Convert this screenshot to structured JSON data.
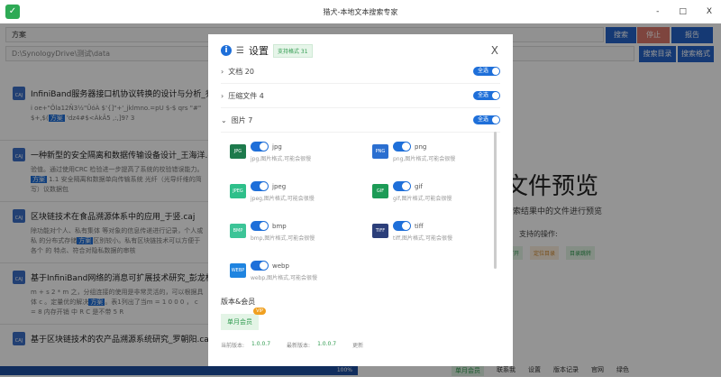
{
  "window": {
    "title": "猎犬-本地文本搜索专家",
    "minimize": "-",
    "maximize": "□",
    "close": "X"
  },
  "search": {
    "query": "方案",
    "path": "D:\\SynologyDrive\\测试\\data",
    "search_btn": "搜索",
    "stop_btn": "停止",
    "report_btn": "报告",
    "dir_btn": "搜索目录",
    "format_btn": "搜索格式"
  },
  "results": [
    {
      "title": "InfiniBand服务器接口机协议转换的设计与分析_乔楠.caj",
      "snippet_pre": "i oe+\"Ôla12Ñ3½\"ÛóÀ $'{]\"+'_jklmno.=pU $-$ qrs \"#\" $+,$(",
      "hl": "方案",
      "snippet_post": " 'dz4#$<ÀkÂ5 ,:,]9? 3"
    },
    {
      "title": "一种新型的安全隔离和数据传输设备设计_王海洋.caj",
      "snippet_pre": "验值。通过使用CRC 检验进一步提高了系统的校验错误能力。 ",
      "hl": "方案",
      "snippet_post": " 1.1 安全隔离和数据单向传输系统 光纤（光导纤维的简写）议数据包"
    },
    {
      "title": "区块链技术在食品溯源体系中的应用_于竖.caj",
      "snippet_pre": "除功能对个人、私有集体 等对象的信息传递进行记录，个人或私 的分布式存储",
      "hl": "方案",
      "snippet_post": "区别较小。私有区块链技术可以方便于各个 的 特点、符合对隐私数据的审核"
    },
    {
      "title": "基于InfiniBand网络的消息可扩展技术研究_彭龙根.caj",
      "snippet_pre": "m + s 2 * m 之，分组连接的使用是非常灵活的，可以根据具体 c 。定量优的解决",
      "hl": "方案",
      "snippet_post": "。表1列出了当m = 1 0 0 0 ， c = 8 内存开销 中 R C 是不带 5 R"
    },
    {
      "title": "基于区块链技术的农产品溯源系统研究_罗朝阳.caj",
      "snippet_pre": "",
      "hl": "",
      "snippet_post": ""
    }
  ],
  "preview": {
    "title": "文件预览",
    "subtitle": "搜索结果中的文件进行预览",
    "ops_label": "支持的操作:",
    "tags": [
      "打开",
      "定位目录",
      "目录跳转"
    ]
  },
  "bottom": {
    "progress": "100%",
    "progress_value": 100,
    "items": [
      "单月会员",
      "联系我",
      "设置",
      "版本记录",
      "官网",
      "绿色"
    ]
  },
  "modal": {
    "title": "设置",
    "badge": "支持格式 31",
    "close": "X",
    "categories": [
      {
        "label": "文档 20",
        "expanded": false,
        "select_all": "全选"
      },
      {
        "label": "压缩文件 4",
        "expanded": false,
        "select_all": "全选"
      },
      {
        "label": "图片 7",
        "expanded": true,
        "select_all": "全选"
      }
    ],
    "formats": [
      {
        "name": "jpg",
        "desc": "jpg,图片格式,可能会很慢",
        "icon": "jpg-icon",
        "color": "#1d7a4c",
        "enabled": true
      },
      {
        "name": "png",
        "desc": "png,图片格式,可能会很慢",
        "icon": "png-icon",
        "color": "#2b6fd0",
        "enabled": true
      },
      {
        "name": "jpeg",
        "desc": "jpeg,图片格式,可能会很慢",
        "icon": "jpeg-icon",
        "color": "#2ebf8a",
        "enabled": true
      },
      {
        "name": "gif",
        "desc": "gif,图片格式,可能会很慢",
        "icon": "gif-icon",
        "color": "#1c9b56",
        "enabled": true
      },
      {
        "name": "bmp",
        "desc": "bmp,图片格式,可能会很慢",
        "icon": "bmp-icon",
        "color": "#3cc497",
        "enabled": true
      },
      {
        "name": "tiff",
        "desc": "tiff,图片格式,可能会很慢",
        "icon": "tiff-icon",
        "color": "#2c3f7a",
        "enabled": true
      },
      {
        "name": "webp",
        "desc": "webp,图片格式,可能会很慢",
        "icon": "webp-icon",
        "color": "#1f84e0",
        "enabled": true
      }
    ],
    "version_section": "版本&会员",
    "membership": "单月会员",
    "vip": "VIP",
    "current_label": "当前版本:",
    "current": "1.0.0.7",
    "latest_label": "最新版本:",
    "latest": "1.0.0.7",
    "update": "更新"
  }
}
